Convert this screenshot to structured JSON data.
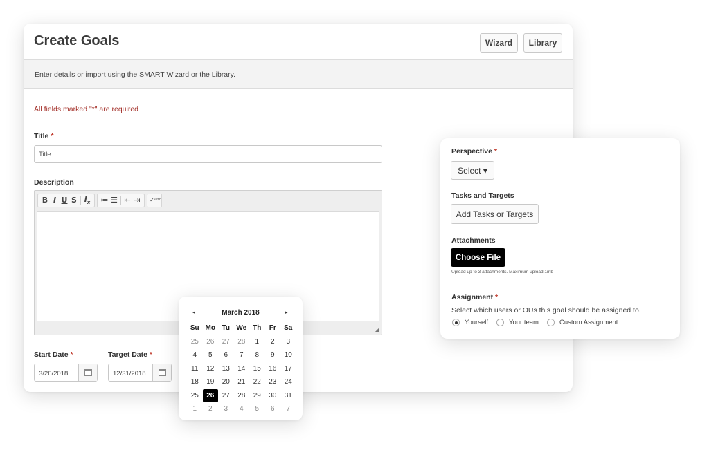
{
  "main": {
    "title": "Create Goals",
    "wizard_label": "Wizard",
    "library_label": "Library",
    "banner": "Enter details or import using the SMART Wizard or the Library.",
    "required_note": "All fields marked \"*\" are required",
    "title_label": "Title",
    "title_placeholder": "Title",
    "description_label": "Description",
    "toolbar": [
      "B",
      "I",
      "U",
      "S",
      "Ix",
      "numbered-list",
      "bulleted-list",
      "outdent",
      "indent",
      "spellcheck"
    ],
    "start_date_label": "Start Date",
    "start_date_value": "3/26/2018",
    "target_date_label": "Target Date",
    "target_date_value": "12/31/2018",
    "required_marker": "*"
  },
  "side": {
    "perspective_label": "Perspective",
    "select_label": "Select ▾",
    "tasks_label": "Tasks and Targets",
    "add_tasks_label": "Add Tasks or Targets",
    "attachments_label": "Attachments",
    "choose_file_label": "Choose File",
    "upload_note": "Upload up to 3 attachments. Maximum upload 1mb",
    "assignment_label": "Assignment",
    "assignment_desc": "Select which users or OUs this goal should be assigned to.",
    "options": [
      {
        "label": "Yourself",
        "selected": true
      },
      {
        "label": "Your team",
        "selected": false
      },
      {
        "label": "Custom Assignment",
        "selected": false
      }
    ]
  },
  "calendar": {
    "month": "March 2018",
    "prev": "◂",
    "next": "▸",
    "weekdays": [
      "Su",
      "Mo",
      "Tu",
      "We",
      "Th",
      "Fr",
      "Sa"
    ],
    "weeks": [
      [
        "25",
        "26",
        "27",
        "28",
        "1",
        "2",
        "3"
      ],
      [
        "4",
        "5",
        "6",
        "7",
        "8",
        "9",
        "10"
      ],
      [
        "11",
        "12",
        "13",
        "14",
        "15",
        "16",
        "17"
      ],
      [
        "18",
        "19",
        "20",
        "21",
        "22",
        "23",
        "24"
      ],
      [
        "25",
        "26",
        "27",
        "28",
        "29",
        "30",
        "31"
      ],
      [
        "1",
        "2",
        "3",
        "4",
        "5",
        "6",
        "7"
      ]
    ],
    "selected_day": "26"
  },
  "colors": {
    "required": "#c0392b",
    "note": "#a4322b",
    "selected_day_bg": "#000000"
  }
}
